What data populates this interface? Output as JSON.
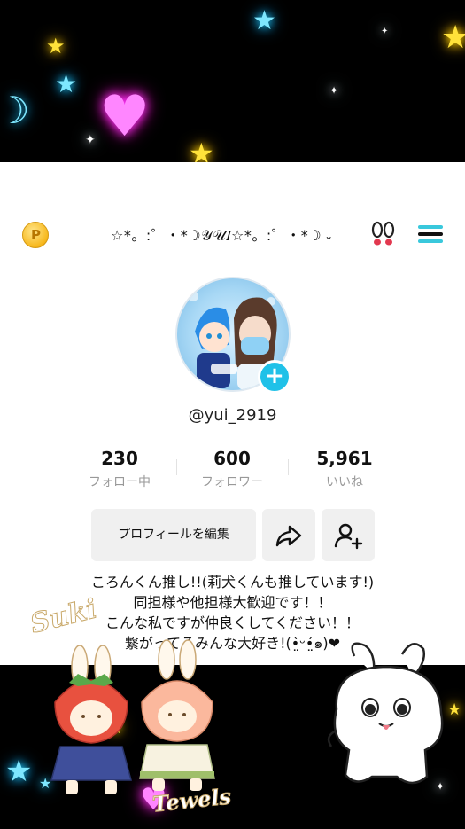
{
  "header": {
    "username": "☆*。:゜・*☽𝒴𝒰𝐼☆*。:゜・*☽",
    "chevron": "⌄"
  },
  "profile": {
    "handle": "@yui_2919",
    "plus": "+"
  },
  "stats": [
    {
      "value": "230",
      "label": "フォロー中"
    },
    {
      "value": "600",
      "label": "フォロワー"
    },
    {
      "value": "5,961",
      "label": "いいね"
    }
  ],
  "actions": {
    "edit_profile": "プロフィールを編集"
  },
  "bio": [
    "ころんくん推し!!(莉犬くんも推しています!)",
    "同担様や他担様大歓迎です！！",
    "こんな私ですが仲良くしてください！！",
    "繋がってるみんな大好き!(•̤̀ᵕ•̤́๑)❤"
  ],
  "stickers": {
    "top_text": "Suki",
    "bottom_text": "Tewels"
  },
  "colors": {
    "accent": "#20c1e8",
    "coin": "#f7b81d"
  }
}
